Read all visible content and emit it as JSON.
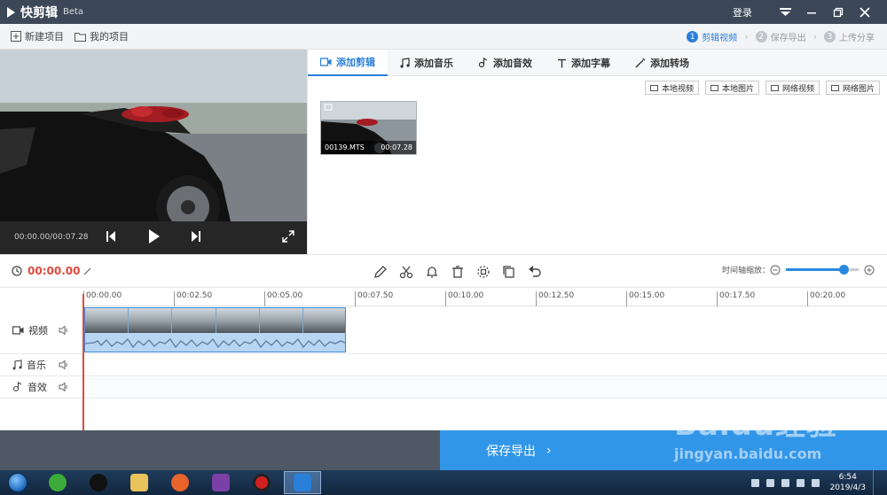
{
  "titlebar": {
    "app_name": "快剪辑",
    "beta": "Beta",
    "login": "登录"
  },
  "toolbar": {
    "new_project": "新建项目",
    "my_projects": "我的项目"
  },
  "steps": [
    {
      "num": "1",
      "label": "剪辑视频"
    },
    {
      "num": "2",
      "label": "保存导出"
    },
    {
      "num": "3",
      "label": "上传分享"
    }
  ],
  "preview": {
    "timecode": "00:00.00/00:07.28"
  },
  "tabs": [
    "添加剪辑",
    "添加音乐",
    "添加音效",
    "添加字幕",
    "添加转场"
  ],
  "sources": [
    "本地视频",
    "本地图片",
    "网络视频",
    "网络图片"
  ],
  "clip": {
    "name": "00139.MTS",
    "duration": "00:07.28"
  },
  "edit": {
    "current_time": "00:00.00",
    "zoom_label": "时间轴缩放："
  },
  "ruler": [
    "00:00.00",
    "00:02.50",
    "00:05.00",
    "00:07.50",
    "00:10.00",
    "00:12.50",
    "00:15.00",
    "00:17.50",
    "00:20.00"
  ],
  "tracks": {
    "video": "视频",
    "music": "音乐",
    "sfx": "音效"
  },
  "export": {
    "label": "保存导出"
  },
  "watermark": {
    "logo": "Baidu经验",
    "url": "jingyan.baidu.com"
  },
  "clock": {
    "time": "6:54",
    "date": "2019/4/3"
  }
}
